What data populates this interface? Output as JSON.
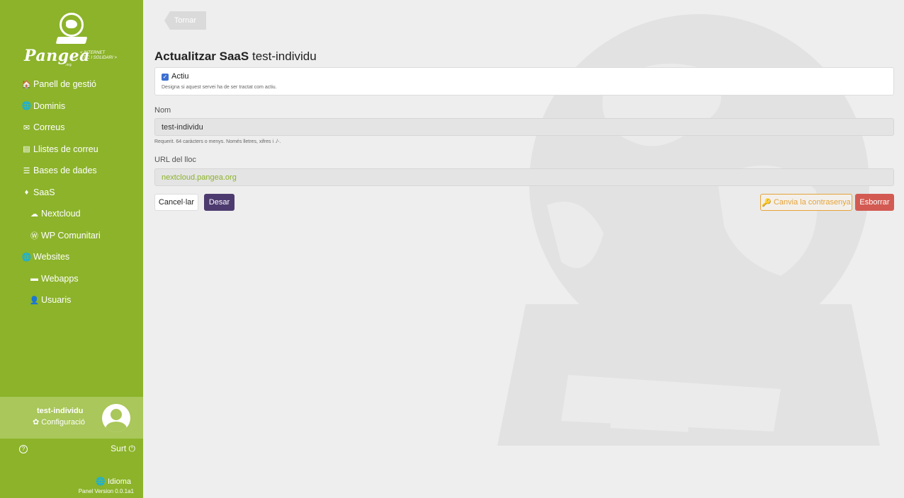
{
  "sidebar": {
    "brand": "Pangea",
    "tagline_1": "< INTERNET",
    "tagline_2": "ÈTIC I SOLIDARI >",
    "brand_suffix": ".org",
    "items": [
      {
        "label": "Panell de gestió",
        "icon": "home-icon",
        "glyph": "🏠"
      },
      {
        "label": "Dominis",
        "icon": "globe-icon",
        "glyph": "🌐"
      },
      {
        "label": "Correus",
        "icon": "envelope-icon",
        "glyph": "✉"
      },
      {
        "label": "Llistes de correu",
        "icon": "mail-bulk-icon",
        "glyph": "▤"
      },
      {
        "label": "Bases de dades",
        "icon": "database-icon",
        "glyph": "☰"
      },
      {
        "label": "SaaS",
        "icon": "fire-icon",
        "glyph": "♦"
      },
      {
        "label": "Nextcloud",
        "icon": "cloud-icon",
        "glyph": "☁"
      },
      {
        "label": "WP Comunitari",
        "icon": "wordpress-icon",
        "glyph": "Ⓦ"
      },
      {
        "label": "Websites",
        "icon": "globe-icon",
        "glyph": "🌐"
      },
      {
        "label": "Webapps",
        "icon": "folder-icon",
        "glyph": "▬"
      },
      {
        "label": "Usuaris",
        "icon": "user-icon",
        "glyph": "👤"
      }
    ],
    "user": {
      "name": "test-individu",
      "config_label": "Configuració",
      "config_glyph": "✿"
    },
    "help_glyph": "?",
    "logout_label": "Surt",
    "logout_glyph": "⏻",
    "lang_label": "Idioma",
    "lang_glyph": "🌐",
    "version": "Panel Version 0.0.1a1"
  },
  "main": {
    "back_label": "Tornar",
    "title_bold": "Actualitzar SaaS",
    "title_name": "test-individu",
    "active": {
      "label": "Actiu",
      "checked": true,
      "check_glyph": "✓",
      "help": "Designa si aquest servei ha de ser tractat com actiu."
    },
    "name_field": {
      "label": "Nom",
      "value": "test-individu",
      "help": "Requerit. 64 caràcters o menys. Només lletres, xifres i ./-."
    },
    "url_field": {
      "label": "URL del lloc",
      "value": "nextcloud.pangea.org"
    },
    "buttons": {
      "cancel": "Cancel·lar",
      "save": "Desar",
      "change_password": "Canvia la contrasenya",
      "change_password_glyph": "🔑",
      "delete": "Esborrar"
    }
  }
}
